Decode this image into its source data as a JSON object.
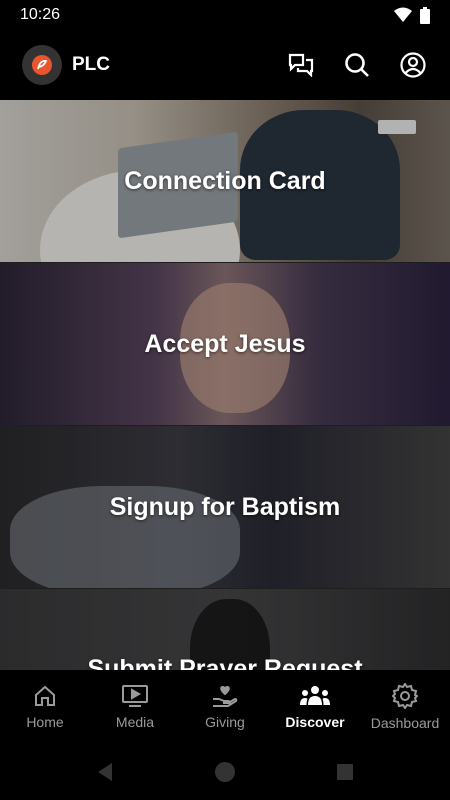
{
  "status_bar": {
    "time": "10:26"
  },
  "header": {
    "app_name": "PLC"
  },
  "cards": [
    {
      "label": "Connection Card"
    },
    {
      "label": "Accept Jesus"
    },
    {
      "label": "Signup for Baptism"
    },
    {
      "label": "Submit Prayer Request"
    }
  ],
  "bottom_nav": {
    "items": [
      {
        "label": "Home",
        "icon": "home-icon"
      },
      {
        "label": "Media",
        "icon": "media-icon"
      },
      {
        "label": "Giving",
        "icon": "giving-icon"
      },
      {
        "label": "Discover",
        "icon": "discover-icon",
        "active": true
      },
      {
        "label": "Dashboard",
        "icon": "gear-icon"
      }
    ]
  },
  "colors": {
    "accent": "#e8552f",
    "inactive": "#9a9a9a",
    "active": "#ffffff"
  }
}
